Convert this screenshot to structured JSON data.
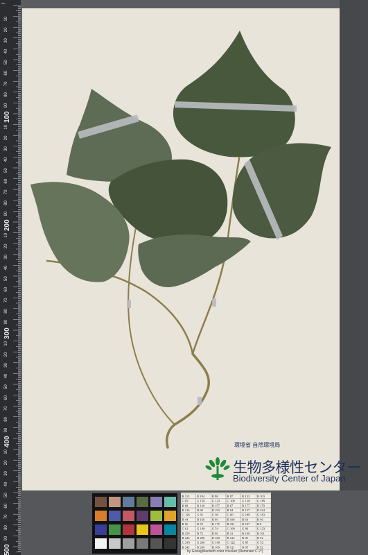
{
  "ruler": {
    "corner_label": "cm",
    "major_labels": [
      "100",
      "200",
      "300",
      "400",
      "500"
    ],
    "minor_labels": [
      "10",
      "20",
      "30",
      "40",
      "50",
      "60",
      "70",
      "80",
      "90"
    ]
  },
  "label": {
    "ministry": "環境省 自然環境局",
    "center_jp": "生物多様性センター",
    "center_en": "Biodiversity Center of Japan",
    "logo_color": "#1f8a3a"
  },
  "color_checker": {
    "swatches": [
      [
        "#735244",
        "#c29682",
        "#627a9d",
        "#576c43",
        "#8580b1",
        "#67bdaa"
      ],
      [
        "#d67e2c",
        "#505ba6",
        "#c15a63",
        "#5e3c6c",
        "#9dbc40",
        "#e0a32e"
      ],
      [
        "#383d96",
        "#469449",
        "#af363c",
        "#e7c71f",
        "#bb5695",
        "#0885a1"
      ],
      [
        "#f3f3f2",
        "#c8c8c8",
        "#a0a0a0",
        "#7a7a79",
        "#555555",
        "#343434"
      ]
    ]
  },
  "rgb_table": {
    "rows": [
      [
        "R 115",
        "R 194",
        "R 98",
        "R 87",
        "R 133",
        "R 103"
      ],
      [
        "G 82",
        "G 150",
        "G 122",
        "G 108",
        "G 128",
        "G 189"
      ],
      [
        "B 68",
        "B 130",
        "B 157",
        "B 67",
        "B 177",
        "B 170"
      ],
      [
        "R 214",
        "R 80",
        "R 193",
        "R 94",
        "R 157",
        "R 224"
      ],
      [
        "G 126",
        "G 91",
        "G 90",
        "G 60",
        "G 188",
        "G 163"
      ],
      [
        "B 44",
        "B 166",
        "B 99",
        "B 108",
        "B 64",
        "B 46"
      ],
      [
        "R 56",
        "R 70",
        "R 175",
        "R 231",
        "R 187",
        "R 8"
      ],
      [
        "G 61",
        "G 148",
        "G 54",
        "G 199",
        "G 86",
        "G 133"
      ],
      [
        "B 150",
        "B 73",
        "B 60",
        "B 31",
        "B 149",
        "B 161"
      ],
      [
        "R 243",
        "R 200",
        "R 160",
        "R 122",
        "R 85",
        "R 52"
      ],
      [
        "G 243",
        "G 200",
        "G 160",
        "G 122",
        "G 85",
        "G 52"
      ],
      [
        "B 242",
        "B 200",
        "B 160",
        "B 121",
        "B 85",
        "B 52"
      ]
    ],
    "footnote": "by GretagMacbeth color checker (Illuminant C 2°)"
  }
}
